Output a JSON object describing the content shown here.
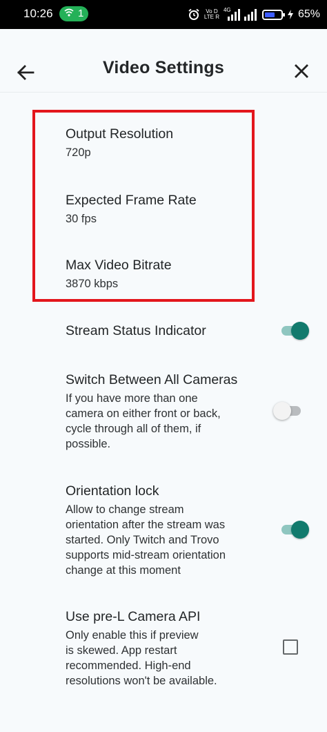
{
  "status_bar": {
    "time": "10:26",
    "hotspot_count": "1",
    "net_label_top": "Vo D",
    "net_label_bottom": "LTE R",
    "net_gen": "4G",
    "battery_percent": "65%",
    "battery_level": 0.65,
    "accent": "#24b158"
  },
  "header": {
    "title": "Video Settings",
    "back_icon": "arrow-left-icon",
    "close_icon": "close-icon"
  },
  "highlight_color": "#e3161c",
  "settings": {
    "output_resolution": {
      "title": "Output Resolution",
      "value": "720p"
    },
    "frame_rate": {
      "title": "Expected Frame Rate",
      "value": "30 fps"
    },
    "bitrate": {
      "title": "Max Video Bitrate",
      "value": "3870 kbps"
    },
    "stream_status": {
      "title": "Stream Status Indicator",
      "enabled": true
    },
    "switch_cameras": {
      "title": "Switch Between All Cameras",
      "summary_lines": [
        "If you have more than one",
        "camera on either front or back,",
        "cycle through all of them, if",
        "possible."
      ],
      "enabled": false
    },
    "orientation_lock": {
      "title": "Orientation lock",
      "summary_lines": [
        "Allow to change stream",
        "orientation after the stream was",
        "started. Only Twitch and Trovo",
        "supports mid-stream orientation",
        "change at this moment"
      ],
      "enabled": true
    },
    "pre_l_camera": {
      "title": "Use pre-L Camera API",
      "summary_lines": [
        "Only enable this if preview",
        "is skewed. App restart",
        "recommended. High-end",
        "resolutions won't be available."
      ],
      "checked": false
    }
  },
  "colors": {
    "switch_on": "#127a6d",
    "switch_track_on": "#8fc6c0"
  }
}
